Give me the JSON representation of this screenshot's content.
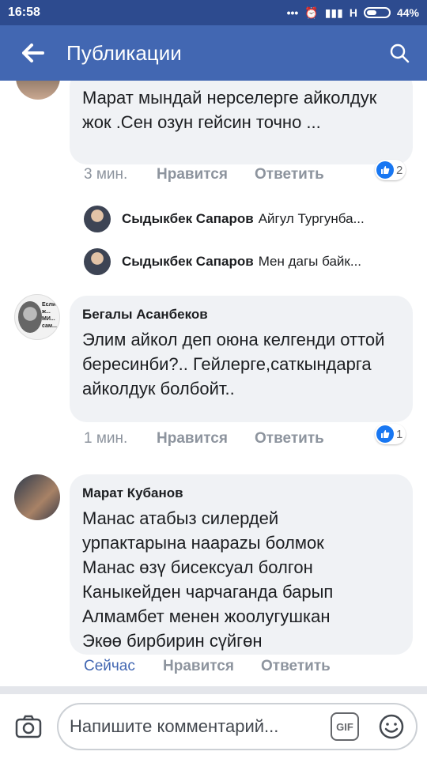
{
  "status_bar": {
    "time": "16:58",
    "network": "H",
    "battery": "44%"
  },
  "app_bar": {
    "title": "Публикации"
  },
  "comments": [
    {
      "name": "",
      "text": "Марат мындай нерселерге айколдук жок .Сен озун гейсин точно ...",
      "time": "3 мин.",
      "like_label": "Нравится",
      "reply_label": "Ответить",
      "reactions": "2"
    },
    {
      "name": "Бегалы Асанбеков",
      "text": "Элим айкол деп оюна келгенди оттой бересинби?.. Гейлерге,саткындарга айколдук болбойт..",
      "time": "1 мин.",
      "like_label": "Нравится",
      "reply_label": "Ответить",
      "reactions": "1"
    },
    {
      "name": "Марат Кубанов",
      "text": "Манас атабыз силердей урпактарына наараzы болмок Манас өзү бисексуал болгон Каныкейден чарчаганда барып Алмамбет менен жоолугушкан Экөө бирбирин сүйгөн",
      "time": "Сейчас",
      "like_label": "Нравится",
      "reply_label": "Ответить"
    }
  ],
  "replies": [
    {
      "name": "Сыдыкбек Сапаров",
      "text": "Айгул Тургунба..."
    },
    {
      "name": "Сыдыкбек Сапаров",
      "text": "Мен дагы байк..."
    }
  ],
  "avatar_caption": "Если ж... МИ... сам...",
  "composer": {
    "placeholder": "Напишите комментарий...",
    "gif_label": "GIF"
  },
  "colors": {
    "brand": "#4267b2",
    "status_bar": "#2d4b8f",
    "bubble": "#f0f2f5",
    "like": "#1877f2"
  }
}
